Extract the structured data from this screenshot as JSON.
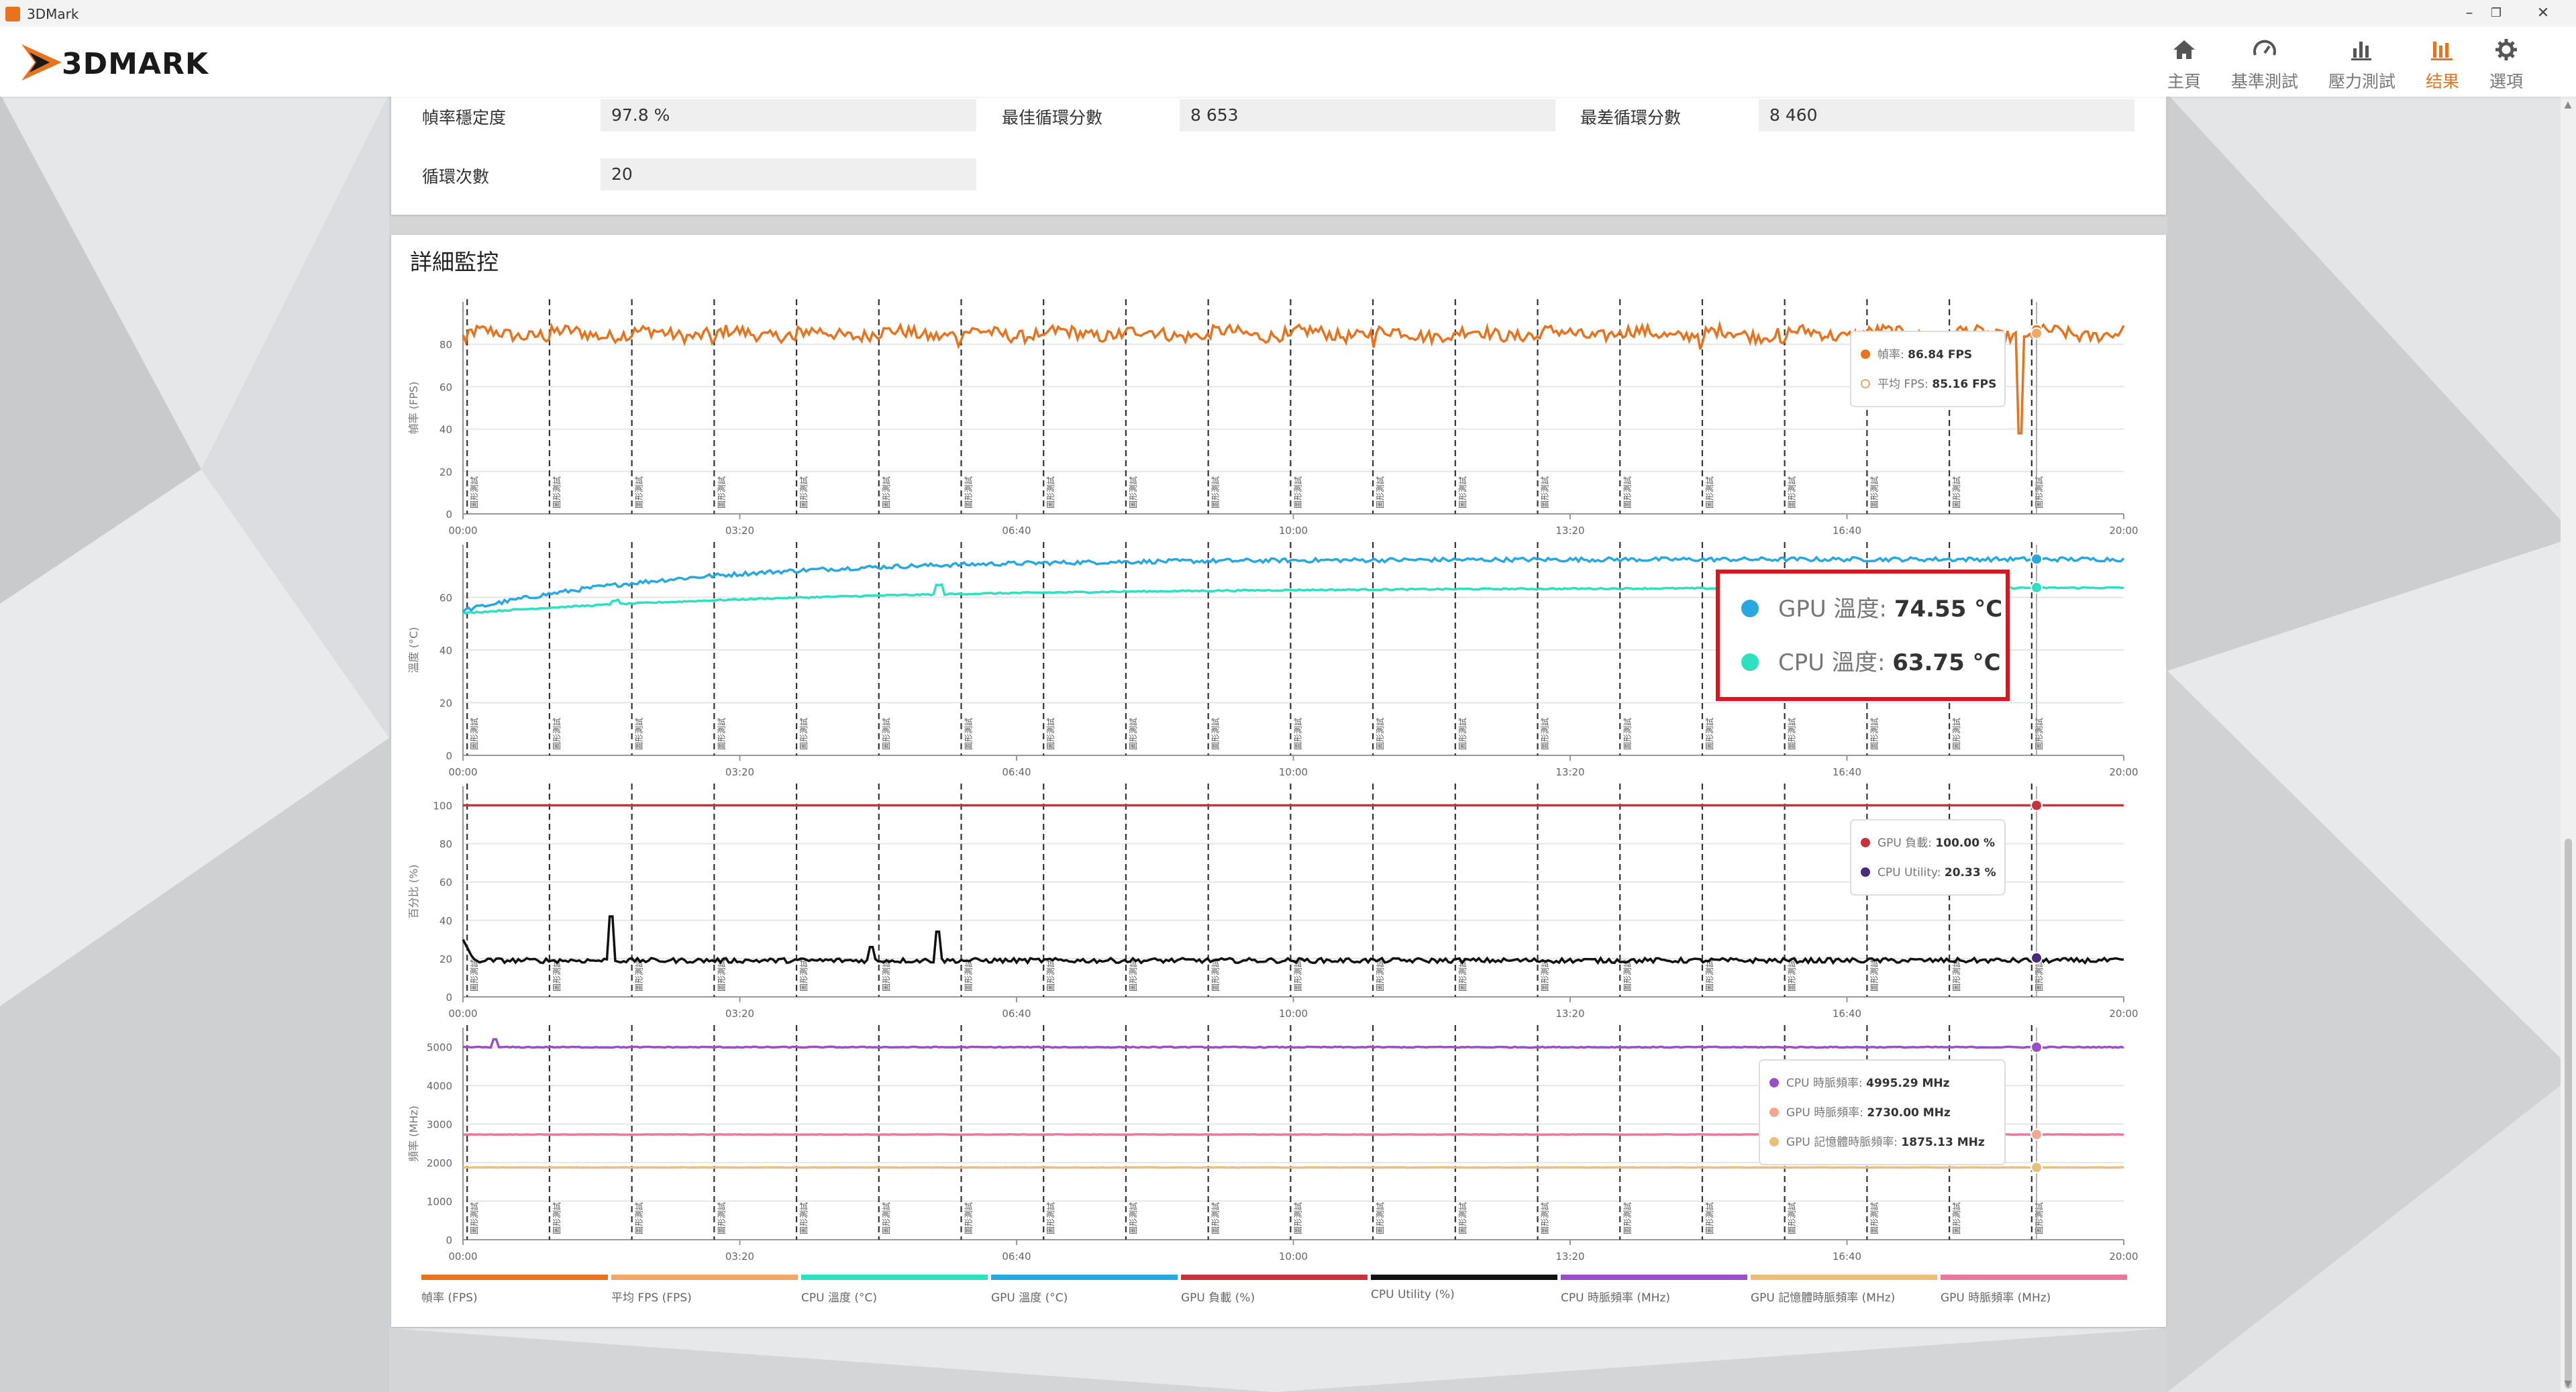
{
  "window": {
    "title": "3DMark",
    "minimize": "–",
    "restore": "❐",
    "close": "✕"
  },
  "header": {
    "brand": "3DMARK",
    "nav": [
      {
        "label": "主頁",
        "icon": "home-icon",
        "active": false
      },
      {
        "label": "基準測試",
        "icon": "gauge-icon",
        "active": false
      },
      {
        "label": "壓力測試",
        "icon": "bar-chart-icon",
        "active": false
      },
      {
        "label": "结果",
        "icon": "results-icon",
        "active": true
      },
      {
        "label": "選項",
        "icon": "gear-icon",
        "active": false
      }
    ],
    "accent": "#e8731e"
  },
  "stats": {
    "frame_stability_label": "幀率穩定度",
    "frame_stability_value": "97.8 %",
    "best_loop_label": "最佳循環分數",
    "best_loop_value": "8 653",
    "worst_loop_label": "最差循環分數",
    "worst_loop_value": "8 460",
    "loop_count_label": "循環次數",
    "loop_count_value": "20"
  },
  "monitor": {
    "title": "詳細監控",
    "marker_label": "圖形測試",
    "legend": [
      {
        "label": "幀率 (FPS)",
        "color": "#e8731e"
      },
      {
        "label": "平均 FPS (FPS)",
        "color": "#f0a868"
      },
      {
        "label": "CPU 溫度 (°C)",
        "color": "#2de0c0"
      },
      {
        "label": "GPU 溫度 (°C)",
        "color": "#27a8e0"
      },
      {
        "label": "GPU 負載 (%)",
        "color": "#c8323c"
      },
      {
        "label": "CPU Utility (%)",
        "color": "#111111"
      },
      {
        "label": "CPU 時脈頻率 (MHz)",
        "color": "#9a4fc8"
      },
      {
        "label": "GPU 記憶體時脈頻率 (MHz)",
        "color": "#e8c07a"
      },
      {
        "label": "GPU 時脈頻率 (MHz)",
        "color": "#e87aa0"
      }
    ]
  },
  "chart_data": [
    {
      "type": "line",
      "ylabel": "幀率 (FPS)",
      "ylim": [
        0,
        100
      ],
      "yticks": [
        "0",
        "20",
        "40",
        "60",
        "80"
      ],
      "x_ticks": [
        "00:00",
        "03:20",
        "06:40",
        "10:00",
        "13:20",
        "16:40",
        "20:00"
      ],
      "xlim_seconds": [
        0,
        1200
      ],
      "series": [
        {
          "name": "幀率",
          "color": "#e8731e",
          "base": 85,
          "noise": 6,
          "dip_at": 1125,
          "dip_to": 38
        }
      ],
      "tooltip": [
        {
          "label": "幀率",
          "value": "86.84 FPS",
          "color": "#e8731e",
          "hollow": false
        },
        {
          "label": "平均 FPS",
          "value": "85.16 FPS",
          "color": "#f0a868",
          "hollow": true
        }
      ]
    },
    {
      "type": "line",
      "ylabel": "溫度 (°C)",
      "ylim": [
        0,
        80
      ],
      "yticks": [
        "0",
        "20",
        "40",
        "60"
      ],
      "x_ticks": [
        "00:00",
        "03:20",
        "06:40",
        "10:00",
        "13:20",
        "16:40",
        "20:00"
      ],
      "series": [
        {
          "name": "GPU 溫度",
          "color": "#27a8e0",
          "start": 55,
          "end": 74.5
        },
        {
          "name": "CPU 溫度",
          "color": "#2de0c0",
          "start": 54,
          "end": 63.75
        }
      ],
      "tooltip": [
        {
          "label": "GPU 溫度",
          "value": "74.55 °C",
          "color": "#27a8e0"
        },
        {
          "label": "CPU 溫度",
          "value": "63.75 °C",
          "color": "#2de0c0"
        }
      ]
    },
    {
      "type": "line",
      "ylabel": "百分比 (%)",
      "ylim": [
        0,
        110
      ],
      "yticks": [
        "0",
        "20",
        "40",
        "60",
        "80",
        "100"
      ],
      "x_ticks": [
        "00:00",
        "03:20",
        "06:40",
        "10:00",
        "13:20",
        "16:40",
        "20:00"
      ],
      "series": [
        {
          "name": "GPU 負載",
          "color": "#c8323c",
          "level": 100
        },
        {
          "name": "CPU Utility",
          "color": "#111111",
          "level": 19,
          "spikes": [
            [
              107,
              46
            ],
            [
              295,
              30
            ],
            [
              343,
              38
            ]
          ]
        }
      ],
      "tooltip": [
        {
          "label": "GPU 負載",
          "value": "100.00 %",
          "color": "#c8323c"
        },
        {
          "label": "CPU Utility",
          "value": "20.33 %",
          "color": "#4a2a7a"
        }
      ]
    },
    {
      "type": "line",
      "ylabel": "頻率 (MHz)",
      "ylim": [
        0,
        5500
      ],
      "yticks": [
        "0",
        "1000",
        "2000",
        "3000",
        "4000",
        "5000"
      ],
      "x_ticks": [
        "00:00",
        "03:20",
        "06:40",
        "10:00",
        "13:20",
        "16:40",
        "20:00"
      ],
      "series": [
        {
          "name": "CPU 時脈頻率",
          "color": "#9a4fc8",
          "level": 4995
        },
        {
          "name": "GPU 時脈頻率",
          "color": "#e87aa0",
          "level": 2730
        },
        {
          "name": "GPU 記憶體時脈頻率",
          "color": "#e8c07a",
          "level": 1875
        }
      ],
      "tooltip": [
        {
          "label": "CPU 時脈頻率",
          "value": "4995.29 MHz",
          "color": "#9a4fc8"
        },
        {
          "label": "GPU 時脈頻率",
          "value": "2730.00 MHz",
          "color": "#f0a890"
        },
        {
          "label": "GPU 記憶體時脈頻率",
          "value": "1875.13 MHz",
          "color": "#e8c07a"
        }
      ]
    }
  ]
}
